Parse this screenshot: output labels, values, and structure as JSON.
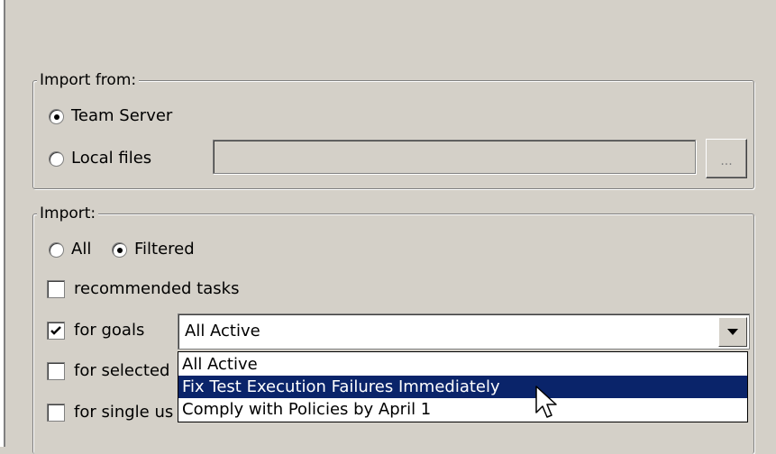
{
  "import_from": {
    "legend": "Import from:",
    "team_server_label": "Team Server",
    "local_files_label": "Local files",
    "local_files_path": "",
    "browse_label": "...",
    "selected": "Team Server"
  },
  "import": {
    "legend": "Import:",
    "all_label": "All",
    "filtered_label": "Filtered",
    "selected": "Filtered",
    "recommended_label": "recommended tasks",
    "recommended_checked": false,
    "goals_label": "for goals",
    "goals_checked": true,
    "goals_value": "All Active",
    "selected_label": "for selected",
    "selected_checked": false,
    "single_label": "for single us",
    "single_checked": false
  },
  "goals_dropdown": {
    "options": [
      "All Active",
      "Fix Test Execution Failures Immediately",
      "Comply with Policies by April 1"
    ],
    "highlighted_index": 1
  },
  "colors": {
    "window_bg": "#d4d0c8",
    "selection_bg": "#0a246a",
    "selection_fg": "#ffffff"
  }
}
